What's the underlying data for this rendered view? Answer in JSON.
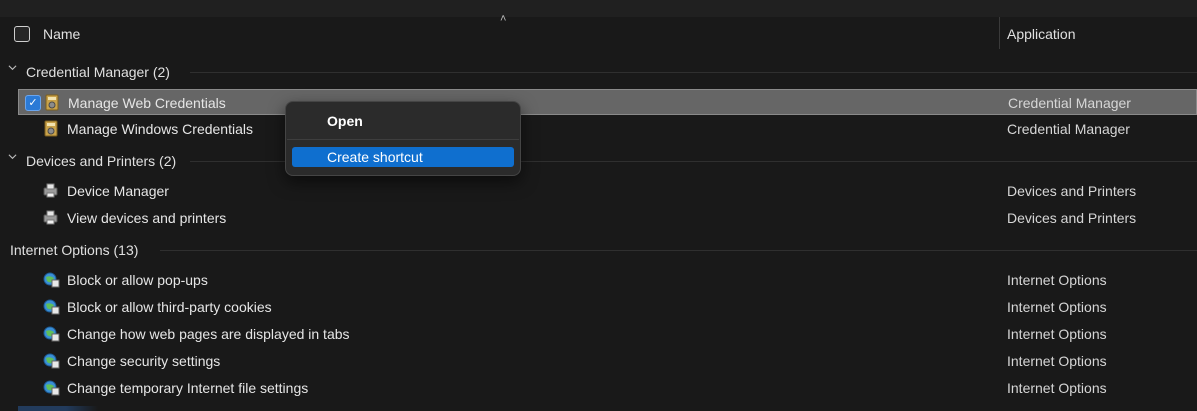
{
  "header": {
    "name_label": "Name",
    "application_label": "Application"
  },
  "groups": [
    {
      "label": "Credential Manager (2)",
      "items": [
        {
          "name": "Manage Web Credentials",
          "app": "Credential Manager",
          "icon": "credential-manager-icon"
        },
        {
          "name": "Manage Windows Credentials",
          "app": "Credential Manager",
          "icon": "credential-manager-icon"
        }
      ]
    },
    {
      "label": "Devices and Printers (2)",
      "items": [
        {
          "name": "Device Manager",
          "app": "Devices and Printers",
          "icon": "printer-icon"
        },
        {
          "name": "View devices and printers",
          "app": "Devices and Printers",
          "icon": "printer-icon"
        }
      ]
    },
    {
      "label": "Internet Options (13)",
      "items": [
        {
          "name": "Block or allow pop-ups",
          "app": "Internet Options",
          "icon": "internet-options-icon"
        },
        {
          "name": "Block or allow third-party cookies",
          "app": "Internet Options",
          "icon": "internet-options-icon"
        },
        {
          "name": "Change how web pages are displayed in tabs",
          "app": "Internet Options",
          "icon": "internet-options-icon"
        },
        {
          "name": "Change security settings",
          "app": "Internet Options",
          "icon": "internet-options-icon"
        },
        {
          "name": "Change temporary Internet file settings",
          "app": "Internet Options",
          "icon": "internet-options-icon"
        }
      ]
    }
  ],
  "context_menu": {
    "open_label": "Open",
    "create_shortcut_label": "Create shortcut"
  },
  "colors": {
    "background": "#191919",
    "selected_row": "#666666",
    "accent": "#0f6fcf"
  }
}
